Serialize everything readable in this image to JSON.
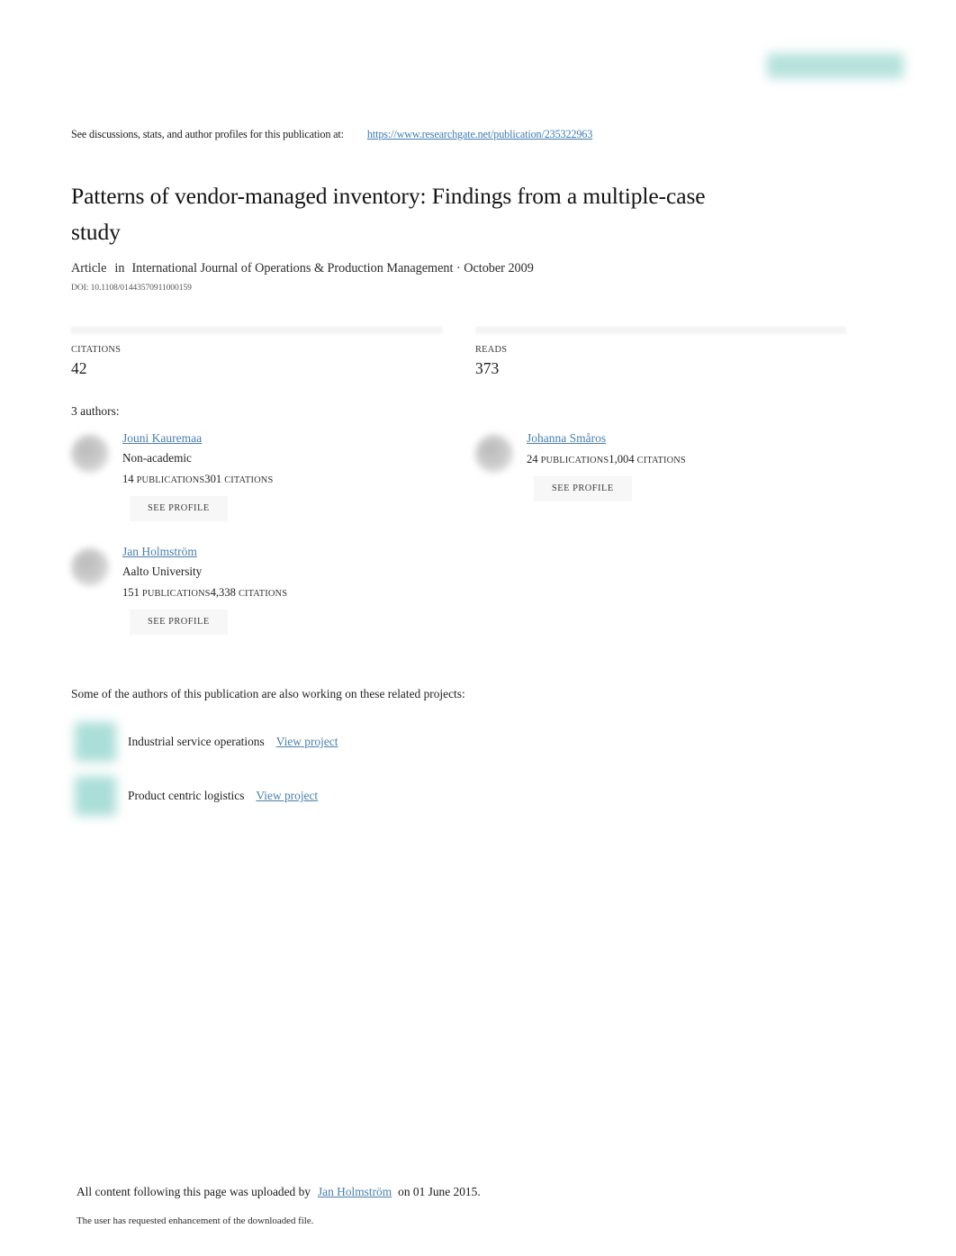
{
  "header": {
    "badge_icon": "researchgate-logo-badge",
    "discuss_text": "See discussions, stats, and author profiles for this publication at:",
    "publication_url": "https://www.researchgate.net/publication/235322963"
  },
  "publication": {
    "title": "Patterns of vendor-managed inventory: Findings from a multiple-case study",
    "type_label": "Article",
    "in_label": "in",
    "venue": "International Journal of Operations & Production Management · October 2009",
    "doi": "DOI: 10.1108/01443570911000159"
  },
  "metrics": [
    {
      "label": "CITATIONS",
      "value": "42"
    },
    {
      "label": "READS",
      "value": "373"
    }
  ],
  "authors_section": {
    "heading": "3 authors:",
    "see_profile_label": "SEE PROFILE",
    "publications_label": "PUBLICATIONS",
    "citations_label": "CITATIONS",
    "authors": [
      {
        "name": "Jouni Kauremaa",
        "affiliation": "Non-academic",
        "publications": "14",
        "citations": "301"
      },
      {
        "name": "Johanna Småros",
        "affiliation": "",
        "publications": "24",
        "citations": "1,004"
      },
      {
        "name": "Jan Holmström",
        "affiliation": "Aalto University",
        "publications": "151",
        "citations": "4,338"
      }
    ]
  },
  "projects_section": {
    "heading": "Some of the authors of this publication are also working on these related projects:",
    "view_label": "View project",
    "projects": [
      {
        "name": "Industrial service operations"
      },
      {
        "name": "Product centric logistics"
      }
    ]
  },
  "footer": {
    "upload_prefix": "All content following this page was uploaded by",
    "upload_author": "Jan Holmström",
    "upload_suffix": "on 01 June 2015.",
    "note": "The user has requested enhancement of the downloaded file."
  },
  "colors": {
    "link": "#4a7fae",
    "teal": "#8fd3cb",
    "text": "#1a1a1a"
  }
}
